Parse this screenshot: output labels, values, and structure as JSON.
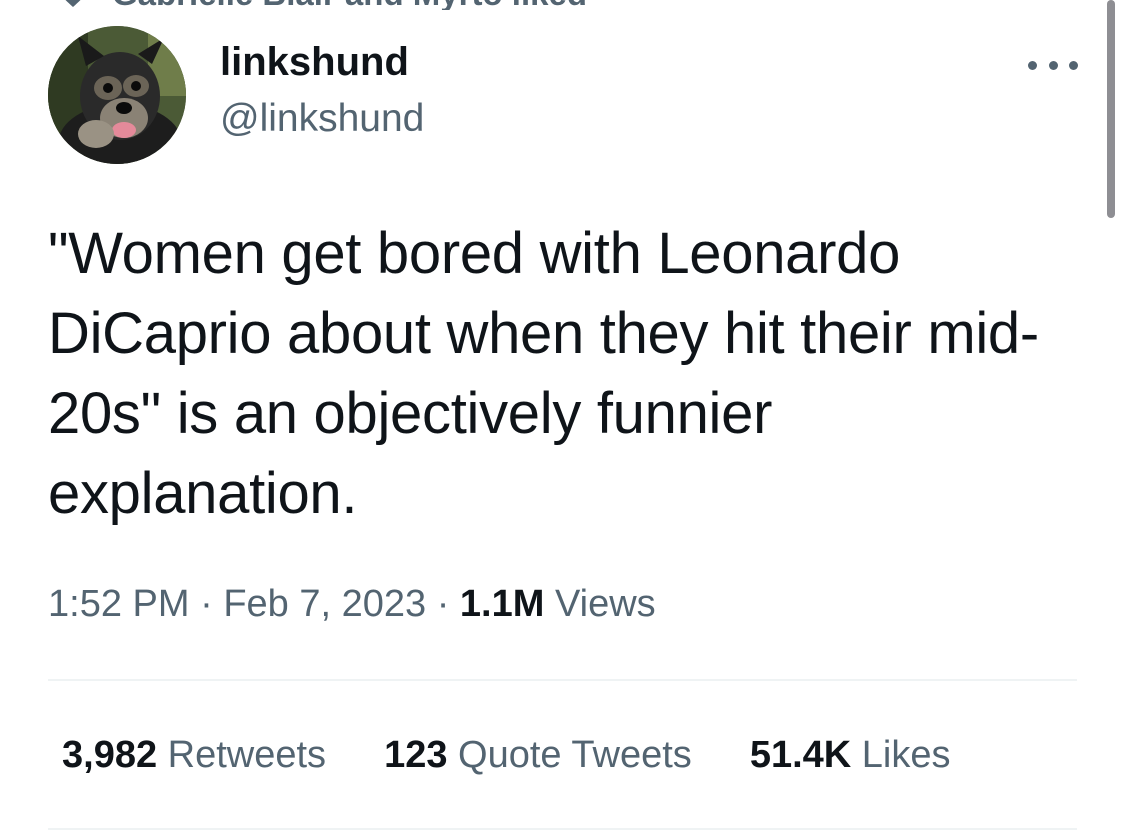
{
  "social_context": {
    "text": "Gabrielle Blair and Myrto liked",
    "icon": "heart-icon"
  },
  "author": {
    "display_name": "linkshund",
    "handle": "@linkshund",
    "avatar": "dog-avatar"
  },
  "tweet": {
    "text": "\"Women get bored with Leonardo DiCaprio about when they hit their mid-20s\" is an objectively funnier explanation."
  },
  "meta": {
    "time": "1:52 PM",
    "separator": "·",
    "date": "Feb 7, 2023",
    "views_count": "1.1M",
    "views_label": "Views"
  },
  "stats": {
    "retweets": {
      "count": "3,982",
      "label": "Retweets"
    },
    "quotes": {
      "count": "123",
      "label": "Quote Tweets"
    },
    "likes": {
      "count": "51.4K",
      "label": "Likes"
    }
  },
  "colors": {
    "text_primary": "#0f1419",
    "text_secondary": "#536471",
    "divider": "#eff3f4"
  }
}
